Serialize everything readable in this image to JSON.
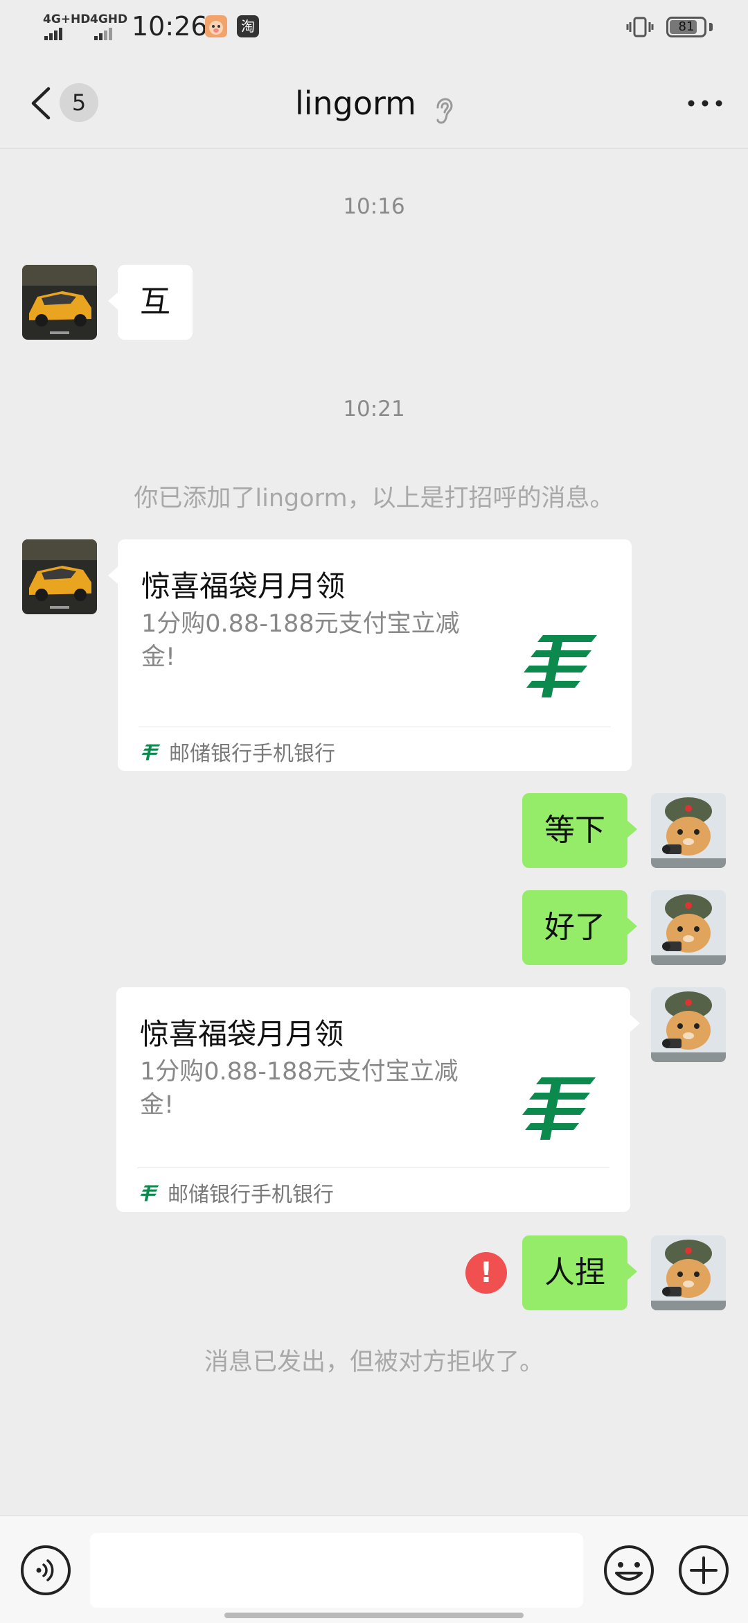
{
  "status_bar": {
    "net1": "4G+HD",
    "net2": "4GHD",
    "time": "10:26",
    "app_icon_1": "pig-app-icon",
    "app_icon_2": "taobao-app-icon",
    "app_icon_2_text": "淘",
    "battery": "81",
    "battery_level": 0.81
  },
  "nav": {
    "unread_count": "5",
    "title": "lingorm"
  },
  "messages": {
    "ts1": "10:16",
    "msg1": "互",
    "ts2": "10:21",
    "system_added": "你已添加了lingorm，以上是打招呼的消息。",
    "card1": {
      "title": "惊喜福袋月月领",
      "desc": "1分购0.88-188元支付宝立减金!",
      "source": "邮储银行手机银行"
    },
    "msg2": "等下",
    "msg3": "好了",
    "card2": {
      "title": "惊喜福袋月月领",
      "desc": "1分购0.88-188元支付宝立减金!",
      "source": "邮储银行手机银行"
    },
    "msg4": "人捏",
    "error_mark": "!",
    "system_rejected": "消息已发出，但被对方拒收了。"
  },
  "input": {
    "placeholder": ""
  },
  "colors": {
    "background": "#ededed",
    "sent_bubble": "#95ec69",
    "received_bubble": "#ffffff",
    "error": "#f05050",
    "postal_green": "#0c8a4e"
  }
}
